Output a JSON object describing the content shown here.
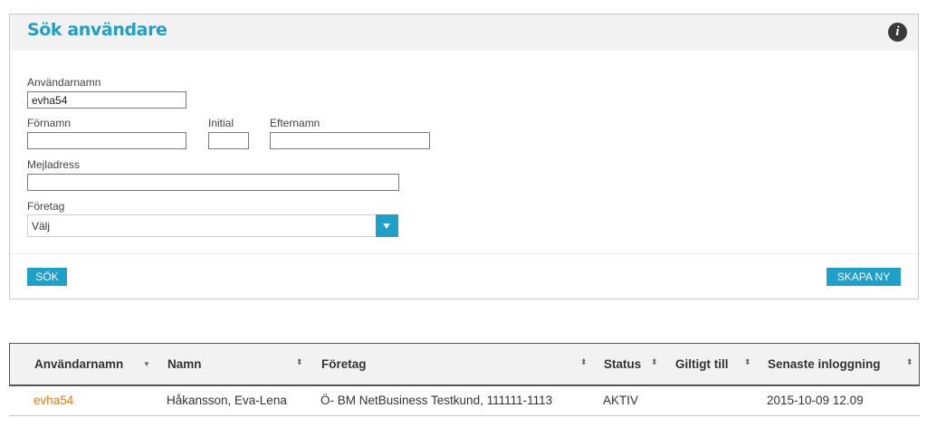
{
  "search_panel": {
    "title": "Sök användare",
    "info_icon": "i",
    "fields": {
      "username": {
        "label": "Användarnamn",
        "value": "evha54"
      },
      "firstname": {
        "label": "Förnamn",
        "value": ""
      },
      "initial": {
        "label": "Initial",
        "value": ""
      },
      "lastname": {
        "label": "Efternamn",
        "value": ""
      },
      "email": {
        "label": "Mejladress",
        "value": ""
      },
      "company": {
        "label": "Företag",
        "selected": "Välj"
      }
    },
    "buttons": {
      "search": "SÖK",
      "create": "SKAPA NY"
    }
  },
  "results": {
    "columns": [
      {
        "label": "Användarnamn",
        "sort_icon": "▼"
      },
      {
        "label": "Namn",
        "sort_icon": "⬍"
      },
      {
        "label": "Företag",
        "sort_icon": "⬍"
      },
      {
        "label": "Status",
        "sort_icon": "⬍"
      },
      {
        "label": "Giltigt till",
        "sort_icon": "⬍"
      },
      {
        "label": "Senaste inloggning",
        "sort_icon": "⬍"
      }
    ],
    "rows": [
      {
        "username": "evha54",
        "name": "Håkansson, Eva-Lena",
        "company": "Ö- BM NetBusiness Testkund, 111111-1113",
        "status": "AKTIV",
        "valid_until": "",
        "last_login": "2015-10-09 12.09"
      }
    ]
  },
  "colors": {
    "accent": "#1fa0c8",
    "link": "#e07b19",
    "header_bg": "#f2f2f2"
  }
}
